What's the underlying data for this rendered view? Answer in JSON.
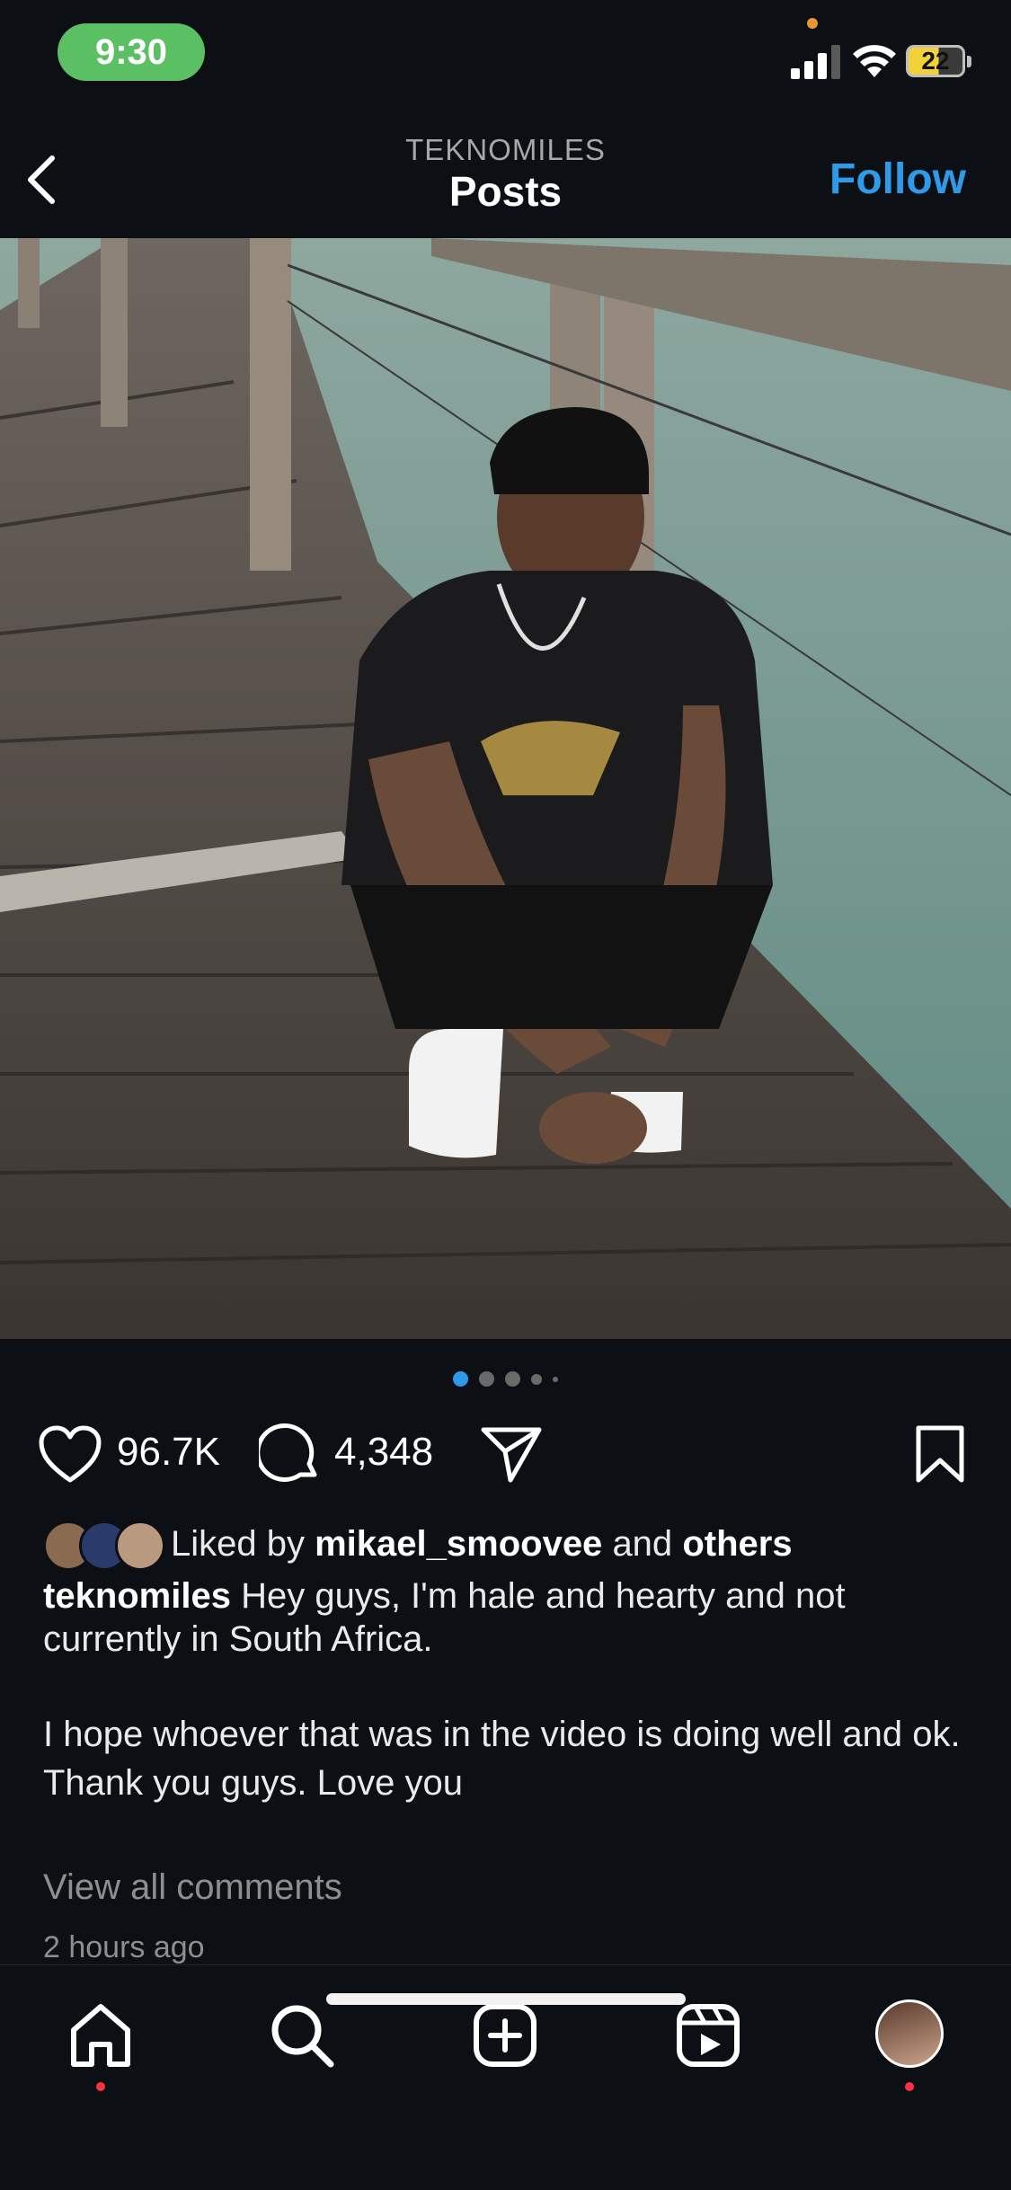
{
  "status_bar": {
    "time": "9:30",
    "battery": "22"
  },
  "header": {
    "username": "TEKNOMILES",
    "title": "Posts",
    "follow_label": "Follow"
  },
  "carousel": {
    "count": 5,
    "active_index": 0
  },
  "actions": {
    "likes": "96.7K",
    "comments": "4,348"
  },
  "liked_by": {
    "prefix": "Liked by",
    "user": "mikael_smoovee",
    "connector": "and",
    "others": "others"
  },
  "caption": {
    "username": "teknomiles",
    "line1": "Hey guys, I'm hale and hearty and not currently in South Africa.",
    "line2": "I hope whoever that was in the video is doing well and ok.",
    "line3": "Thank you guys. Love you"
  },
  "view_comments": "View all comments",
  "timestamp": "2 hours ago",
  "colors": {
    "accent": "#2f9be8",
    "background": "#0c0f14",
    "status_pill": "#5bbf63",
    "notification": "#ff3040"
  },
  "icons": [
    "back-chevron-icon",
    "heart-icon",
    "comment-icon",
    "share-icon",
    "bookmark-icon",
    "home-icon",
    "search-icon",
    "create-icon",
    "reels-icon",
    "profile-avatar"
  ]
}
